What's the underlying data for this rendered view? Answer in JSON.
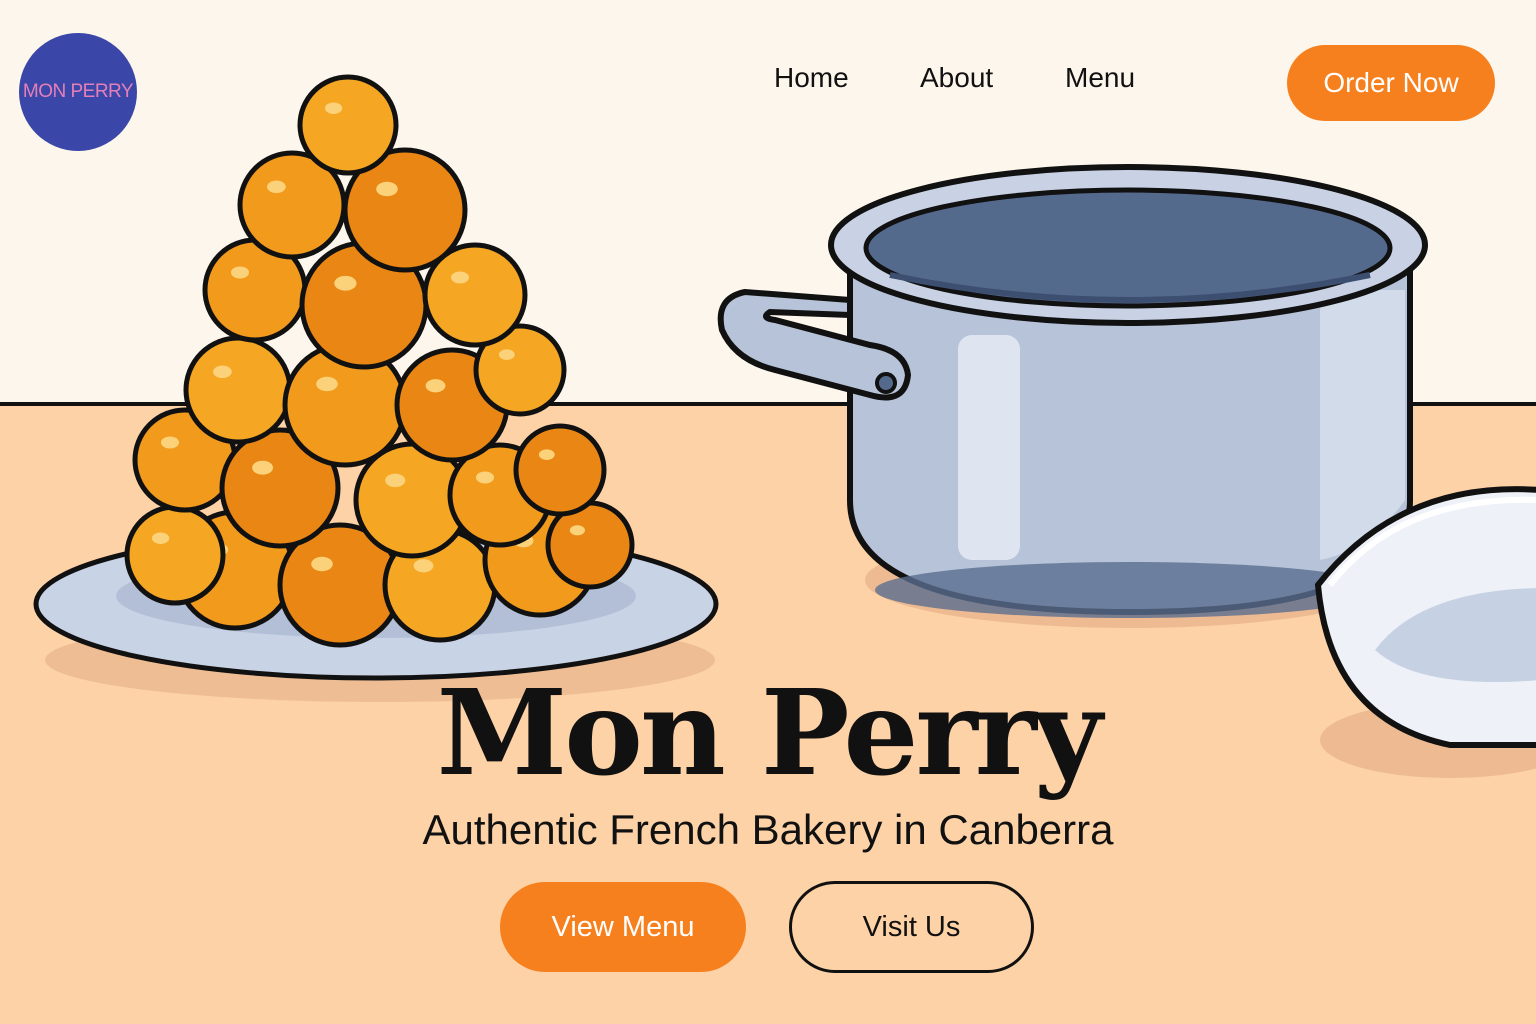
{
  "brand": {
    "logo_text": "MON PERRY"
  },
  "nav": {
    "items": [
      {
        "label": "Home"
      },
      {
        "label": "About"
      },
      {
        "label": "Menu"
      }
    ]
  },
  "header": {
    "cta_label": "Order Now"
  },
  "hero": {
    "title": "Mon Perry",
    "subtitle": "Authentic French Bakery in Canberra",
    "primary_button": "View Menu",
    "secondary_button": "Visit Us"
  },
  "illustration": {
    "items": [
      "croquembouche-on-plate",
      "cooking-pot",
      "bowl"
    ]
  },
  "colors": {
    "accent": "#f7801e",
    "logo_bg": "#3b47a8",
    "logo_text": "#e57fb8",
    "wall": "#fdf6ec",
    "table": "#fdd2a7"
  }
}
